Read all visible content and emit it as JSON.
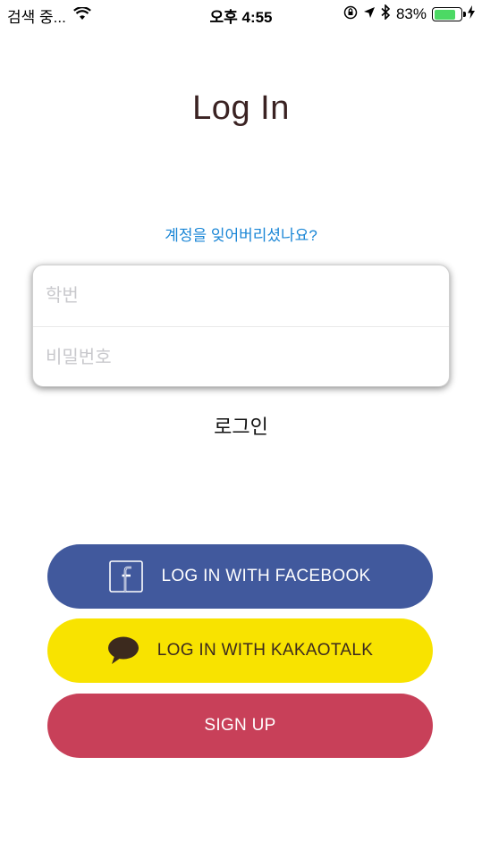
{
  "status_bar": {
    "carrier": "검색 중...",
    "time": "오후 4:55",
    "battery_percent": "83%",
    "battery_level": 0.83,
    "icons": [
      "wifi-icon",
      "orientation-lock-icon",
      "location-arrow-icon",
      "bluetooth-icon",
      "battery-icon",
      "charging-bolt-icon"
    ]
  },
  "page": {
    "title": "Log In",
    "forgot_link": "계정을 잊어버리셨나요?"
  },
  "form": {
    "student_id_placeholder": "학번",
    "password_placeholder": "비밀번호",
    "login_label": "로그인"
  },
  "buttons": {
    "facebook_label": "LOG IN WITH FACEBOOK",
    "kakao_label": "LOG IN WITH KAKAOTALK",
    "signup_label": "SIGN UP"
  },
  "colors": {
    "facebook": "#41599d",
    "kakao": "#f8e300",
    "signup": "#c84059",
    "link": "#1a86d6",
    "battery": "#4cd964"
  }
}
